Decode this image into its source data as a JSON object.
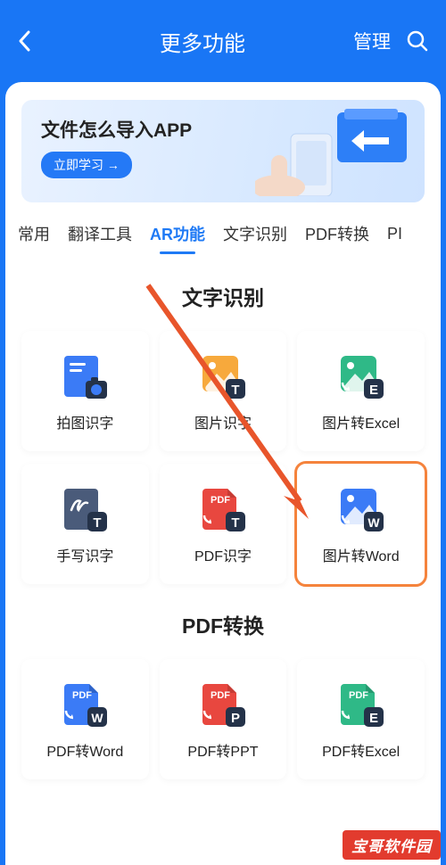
{
  "header": {
    "title": "更多功能",
    "manage": "管理"
  },
  "banner": {
    "title": "文件怎么导入APP",
    "button": "立即学习 →"
  },
  "tabs": [
    "常用",
    "翻译工具",
    "AR功能",
    "文字识别",
    "PDF转换",
    "PI"
  ],
  "activeTab": 2,
  "section1": {
    "title": "文字识别",
    "items": [
      {
        "label": "拍图识字",
        "icon": "photo-text",
        "highlight": false
      },
      {
        "label": "图片识字",
        "icon": "img-text",
        "highlight": false
      },
      {
        "label": "图片转Excel",
        "icon": "img-excel",
        "highlight": false
      },
      {
        "label": "手写识字",
        "icon": "handwrite",
        "highlight": false
      },
      {
        "label": "PDF识字",
        "icon": "pdf-text",
        "highlight": false
      },
      {
        "label": "图片转Word",
        "icon": "img-word",
        "highlight": true
      }
    ]
  },
  "section2": {
    "title": "PDF转换",
    "items": [
      {
        "label": "PDF转Word",
        "icon": "pdf-word"
      },
      {
        "label": "PDF转PPT",
        "icon": "pdf-ppt"
      },
      {
        "label": "PDF转Excel",
        "icon": "pdf-excel"
      }
    ]
  },
  "watermark": "宝哥软件园"
}
